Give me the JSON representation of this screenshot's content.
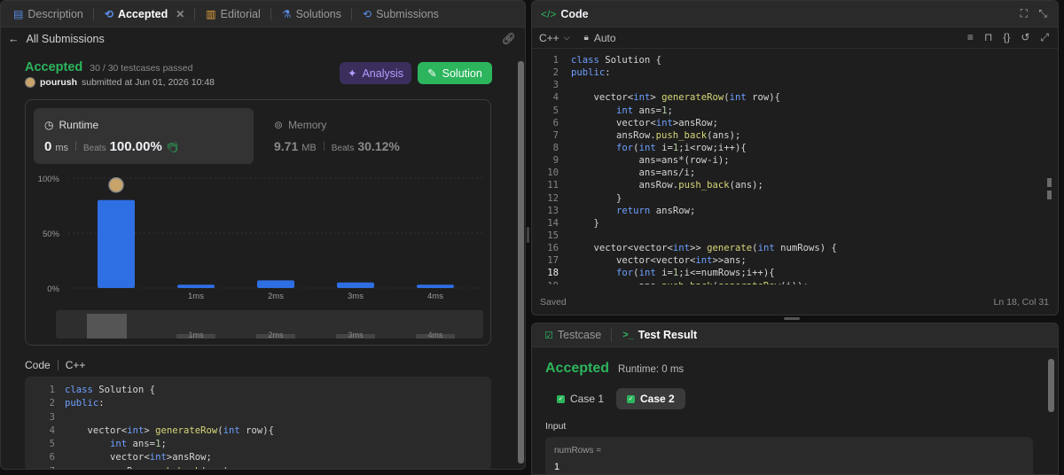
{
  "left": {
    "tabs": [
      {
        "label": "Description",
        "icon": "description-icon"
      },
      {
        "label": "Accepted",
        "icon": "history-icon"
      },
      {
        "label": "Editorial",
        "icon": "book-icon"
      },
      {
        "label": "Solutions",
        "icon": "flask-icon"
      },
      {
        "label": "Submissions",
        "icon": "history-icon"
      }
    ],
    "back_label": "All Submissions",
    "status": "Accepted",
    "testcases": "30 / 30 testcases passed",
    "username": "pourush",
    "submitted": "submitted at Jun 01, 2026 10:48",
    "analysis_label": "Analysis",
    "solution_label": "Solution",
    "runtime": {
      "label": "Runtime",
      "value": "0",
      "unit": "ms",
      "beats_label": "Beats",
      "beats": "100.00%"
    },
    "memory": {
      "label": "Memory",
      "value": "9.71",
      "unit": "MB",
      "beats_label": "Beats",
      "beats": "30.12%"
    },
    "code_label": "Code",
    "lang_label": "C++",
    "code_lines": [
      "class Solution {",
      "public:",
      "",
      "    vector<int> generateRow(int row){",
      "        int ans=1;",
      "        vector<int>ansRow;",
      "        ansRow.push_back(ans);"
    ]
  },
  "chart_data": {
    "type": "bar",
    "categories": [
      "0ms",
      "1ms",
      "2ms",
      "3ms",
      "4ms"
    ],
    "values": [
      80,
      3,
      7,
      5,
      3
    ],
    "ylim": [
      0,
      100
    ],
    "yticks": [
      "100%",
      "50%",
      "0%"
    ],
    "xtick_labels": [
      "",
      "1ms",
      "2ms",
      "3ms",
      "4ms"
    ],
    "bar_color": "#2f6fe4",
    "highlight_category": "0ms"
  },
  "editor": {
    "title": "Code",
    "language": "C++",
    "auto_label": "Auto",
    "saved_label": "Saved",
    "cursor_pos": "Ln 18, Col 31",
    "lines": [
      "class Solution {",
      "public:",
      "",
      "    vector<int> generateRow(int row){",
      "        int ans=1;",
      "        vector<int>ansRow;",
      "        ansRow.push_back(ans);",
      "        for(int i=1;i<row;i++){",
      "            ans=ans*(row-i);",
      "            ans=ans/i;",
      "            ansRow.push_back(ans);",
      "        }",
      "        return ansRow;",
      "    }",
      "",
      "    vector<vector<int>> generate(int numRows) {",
      "        vector<vector<int>>ans;",
      "        for(int i=1;i<=numRows;i++){",
      "            ans.push_back(generateRow(i));"
    ]
  },
  "result": {
    "testcase_tab": "Testcase",
    "result_tab": "Test Result",
    "status": "Accepted",
    "runtime": "Runtime: 0 ms",
    "cases": [
      "Case 1",
      "Case 2"
    ],
    "input_label": "Input",
    "input_name": "numRows =",
    "input_value": "1"
  },
  "colors": {
    "accent_green": "#2db55d",
    "analysis_bg": "#3a2f5c",
    "analysis_fg": "#b49cff",
    "bar_blue": "#2f6fe4"
  }
}
